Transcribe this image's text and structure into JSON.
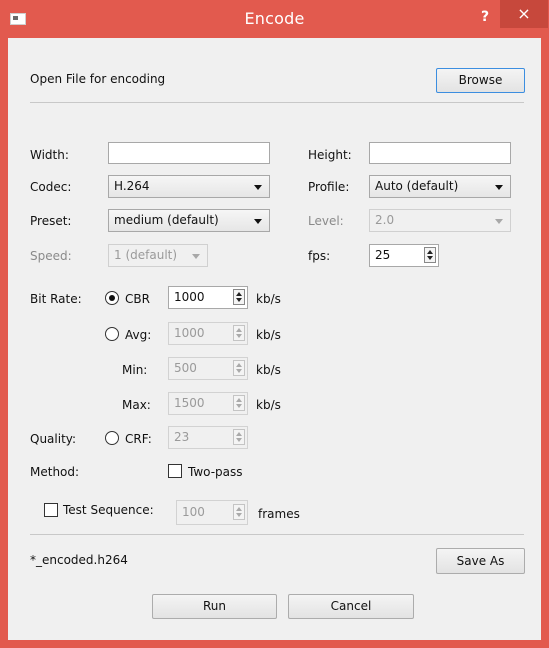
{
  "window": {
    "title": "Encode",
    "help": "?",
    "close": "×"
  },
  "open_file": {
    "label": "Open File for encoding",
    "browse": "Browse"
  },
  "labels": {
    "width": "Width:",
    "height": "Height:",
    "codec": "Codec:",
    "profile": "Profile:",
    "preset": "Preset:",
    "level": "Level:",
    "speed": "Speed:",
    "fps": "fps:",
    "bit_rate": "Bit Rate:",
    "cbr": "CBR",
    "avg": "Avg:",
    "min": "Min:",
    "max": "Max:",
    "quality": "Quality:",
    "crf": "CRF:",
    "method": "Method:",
    "two_pass": "Two-pass",
    "test_sequence": "Test Sequence:",
    "frames": "frames",
    "kbs": "kb/s"
  },
  "values": {
    "width": "",
    "height": "",
    "codec": "H.264",
    "profile": "Auto (default)",
    "preset": "medium (default)",
    "level": "2.0",
    "speed": "1 (default)",
    "fps": "25",
    "cbr": "1000",
    "avg": "1000",
    "min": "500",
    "max": "1500",
    "crf": "23",
    "test_frames": "100"
  },
  "state": {
    "bitrate_mode": "CBR",
    "two_pass": false,
    "test_sequence": false
  },
  "output": {
    "filename": "*_encoded.h264",
    "save_as": "Save As"
  },
  "actions": {
    "run": "Run",
    "cancel": "Cancel"
  },
  "colors": {
    "titlebar": "#e25a4e",
    "close_hover": "#c7483c",
    "dialog_bg": "#f0f0f0"
  }
}
